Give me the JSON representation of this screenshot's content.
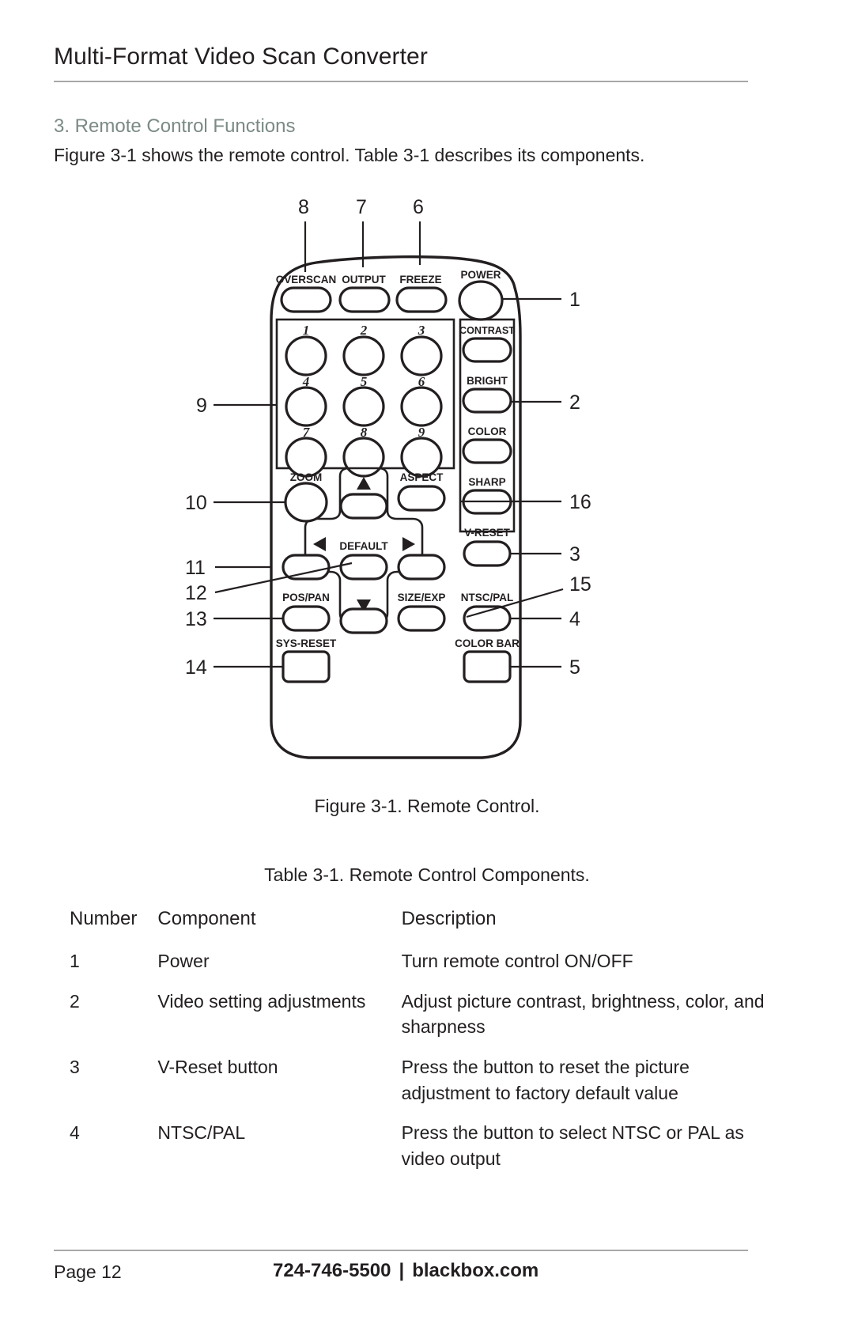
{
  "header": {
    "doc_title": "Multi-Format Video Scan Converter"
  },
  "section": {
    "heading": "3. Remote Control Functions",
    "intro": "Figure 3-1 shows the remote control. Table 3-1 describes its components."
  },
  "figure": {
    "caption": "Figure 3-1. Remote Control.",
    "remote": {
      "top_row_buttons": [
        "OVERSCAN",
        "OUTPUT",
        "FREEZE",
        "POWER"
      ],
      "keypad_numbers": [
        "1",
        "2",
        "3",
        "4",
        "5",
        "6",
        "7",
        "8",
        "9"
      ],
      "right_column_buttons": [
        "CONTRAST",
        "BRIGHT",
        "COLOR",
        "SHARP",
        "V-RESET",
        "NTSC/PAL",
        "COLOR BAR"
      ],
      "left_lower_buttons": [
        "ZOOM",
        "POS/PAN",
        "SYS-RESET"
      ],
      "center_buttons": [
        "DEFAULT"
      ],
      "other_buttons": [
        "ASPECT",
        "SIZE/EXP"
      ],
      "arrow_glyphs": [
        "up-arrow",
        "left-arrow",
        "right-arrow",
        "down-arrow"
      ]
    },
    "callouts": {
      "top": [
        "8",
        "7",
        "6"
      ],
      "left": [
        "9",
        "10",
        "11",
        "12",
        "13",
        "14"
      ],
      "right": [
        "1",
        "2",
        "16",
        "3",
        "15",
        "4",
        "5"
      ]
    }
  },
  "table": {
    "caption": "Table 3-1. Remote Control Components.",
    "headers": [
      "Number",
      "Component",
      "Description"
    ],
    "rows": [
      {
        "number": "1",
        "component": "Power",
        "description": "Turn remote control ON/OFF"
      },
      {
        "number": "2",
        "component": "Video setting adjustments",
        "description": "Adjust picture contrast, brightness, color, and sharpness"
      },
      {
        "number": "3",
        "component": "V-Reset button",
        "description": "Press the button to reset the picture adjustment to factory default value"
      },
      {
        "number": "4",
        "component": "NTSC/PAL",
        "description": "Press the button to select NTSC or PAL as video output"
      }
    ]
  },
  "footer": {
    "page": "Page 12",
    "phone": "724-746-5500",
    "separator": "|",
    "website": "blackbox.com"
  }
}
